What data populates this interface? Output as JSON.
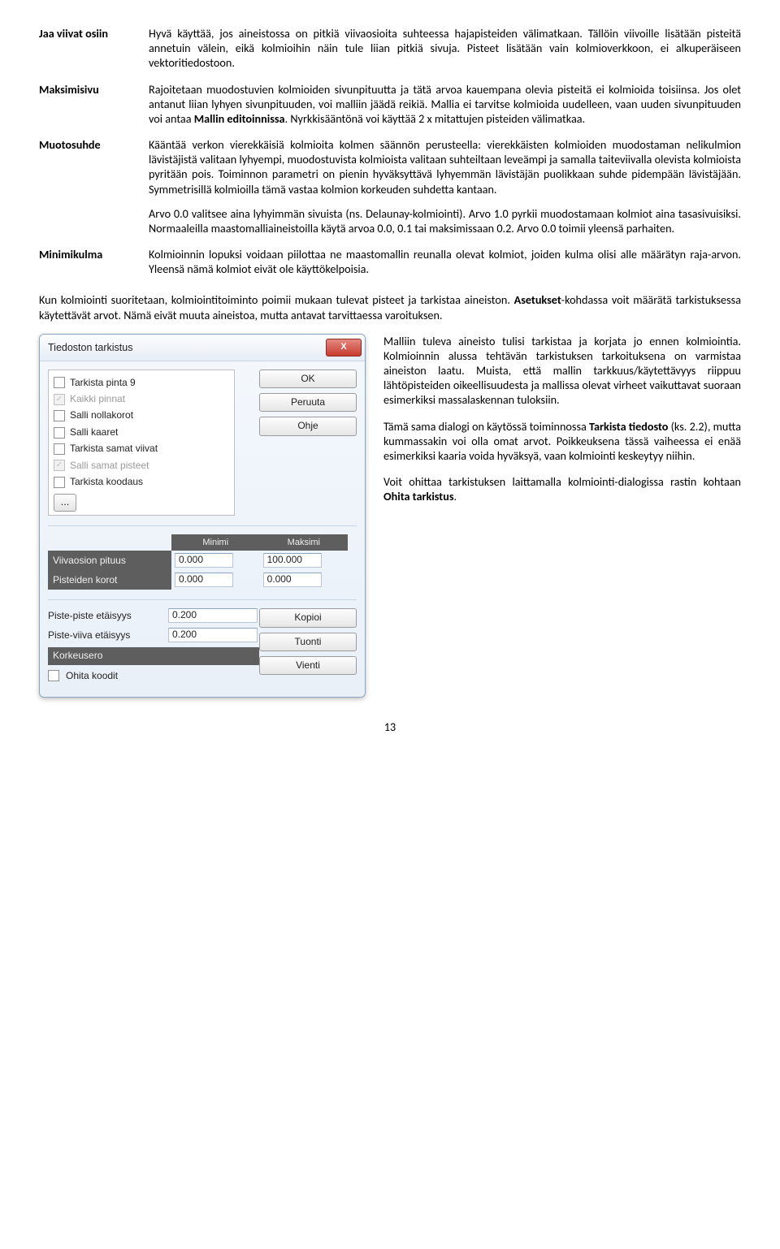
{
  "defs": {
    "term1": "Jaa viivat osiin",
    "body1": "Hyvä käyttää, jos aineistossa on pitkiä viivaosioita suhteessa hajapisteiden välimatkaan. Tällöin viivoille lisätään pisteitä annetuin välein, eikä kolmioihin näin tule liian pitkiä sivuja. Pisteet lisätään vain kolmioverkkoon, ei alkuperäiseen vektoritiedostoon.",
    "term2": "Maksimisivu",
    "body2": "Rajoitetaan muodostuvien kolmioiden sivunpituutta ja tätä arvoa kauempana olevia pisteitä ei kolmioida toisiinsa. Jos olet antanut liian lyhyen sivunpituuden, voi malliin jäädä reikiä. Mallia ei tarvitse kolmioida uudelleen, vaan uuden sivunpituuden voi antaa Mallin editoinnissa. Nyrkkisääntönä voi käyttää 2 x mitattujen pisteiden välimatkaa.",
    "term3": "Muotosuhde",
    "body3a": "Kääntää verkon vierekkäisiä kolmioita kolmen säännön perusteella: vierekkäisten kolmioiden muodostaman nelikulmion lävistäjistä valitaan lyhyempi, muodostuvista kolmioista valitaan suhteiltaan leveämpi ja samalla taiteviivalla olevista kolmioista pyritään pois. Toiminnon parametri on pienin hyväksyttävä lyhyemmän lävistäjän puolikkaan suhde pidempään lävistäjään. Symmetrisillä kolmioilla tämä vastaa kolmion korkeuden suhdetta kantaan.",
    "body3b": "Arvo 0.0 valitsee aina lyhyimmän sivuista (ns. Delaunay-kolmiointi). Arvo 1.0 pyrkii muodostamaan kolmiot aina tasasivuisiksi. Normaaleilla maastomalliaineistoilla käytä arvoa 0.0, 0.1 tai maksimissaan 0.2. Arvo 0.0 toimii yleensä parhaiten.",
    "term4": "Minimikulma",
    "body4": "Kolmioinnin lopuksi voidaan piilottaa ne maastomallin reunalla olevat kolmiot, joiden kulma olisi alle määrätyn raja-arvon. Yleensä nämä kolmiot eivät ole käyttökelpoisia."
  },
  "para_after_defs_a": "Kun kolmiointi suoritetaan, kolmiointitoiminto poimii mukaan tulevat pisteet ja tarkistaa aineiston. ",
  "para_after_defs_bold": "Asetukset",
  "para_after_defs_b": "-kohdassa voit määrätä tarkistuksessa käytettävät arvot. Nämä eivät muuta aineistoa, mutta antavat tarvittaessa varoituksen.",
  "dialog": {
    "title": "Tiedoston tarkistus",
    "close": "X",
    "buttons": {
      "ok": "OK",
      "cancel": "Peruuta",
      "help": "Ohje",
      "copy": "Kopioi",
      "import": "Tuonti",
      "export": "Vienti"
    },
    "ellipsis": "...",
    "checks": {
      "c1": "Tarkista pinta 9",
      "c2": "Kaikki pinnat",
      "c3": "Salli nollakorot",
      "c4": "Salli kaaret",
      "c5": "Tarkista samat viivat",
      "c6": "Salli samat pisteet",
      "c7": "Tarkista koodaus"
    },
    "heads": {
      "min": "Minimi",
      "max": "Maksimi"
    },
    "rows": {
      "viivapituus": "Viivaosion pituus",
      "viivapituus_min": "0.000",
      "viivapituus_max": "100.000",
      "pisteidenkorot": "Pisteiden korot",
      "pisteidenkorot_min": "0.000",
      "pisteidenkorot_max": "0.000",
      "pp": "Piste-piste etäisyys",
      "pp_val": "0.200",
      "pv": "Piste-viiva etäisyys",
      "pv_val": "0.200",
      "korkeusero": "Korkeusero",
      "ohita": "Ohita koodit"
    }
  },
  "side": {
    "p1": "Malliin tuleva aineisto tulisi tarkistaa ja korjata jo ennen kolmiointia. Kolmioinnin alussa tehtävän tarkistuksen tarkoituksena on varmistaa aineiston laatu. Muista, että mallin tarkkuus/käytettävyys riippuu lähtöpisteiden oikeellisuudesta ja mallissa olevat virheet vaikuttavat suoraan esimerkiksi massalaskennan tuloksiin.",
    "p2a": "Tämä sama dialogi on käytössä toiminnossa ",
    "p2bold": "Tarkista tiedosto",
    "p2b": " (ks. 2.2), mutta kummassakin voi olla omat arvot. Poikkeuksena tässä vaiheessa ei enää esimerkiksi kaaria voida hyväksyä, vaan kolmiointi keskeytyy niihin.",
    "p3a": "Voit ohittaa tarkistuksen laittamalla kolmiointi-dialogissa rastin kohtaan ",
    "p3bold": "Ohita tarkistus",
    "p3b": "."
  },
  "page_number": "13"
}
